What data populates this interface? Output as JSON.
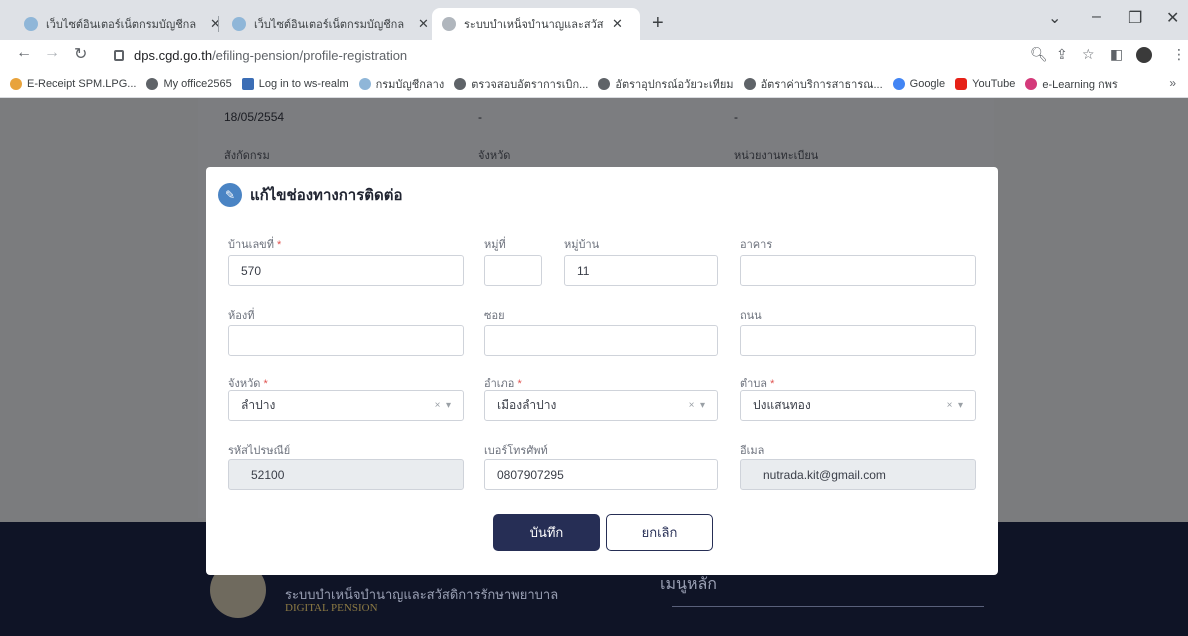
{
  "browser": {
    "tabs": [
      {
        "title": "เว็บไซต์อินเตอร์เน็ตกรมบัญชีกลาง"
      },
      {
        "title": "เว็บไซต์อินเตอร์เน็ตกรมบัญชีกลาง"
      },
      {
        "title": "ระบบบำเหน็จบำนาญและสวัสดิการรักษ"
      }
    ],
    "url_host": "dps.cgd.go.th",
    "url_path": "/efiling-pension/profile-registration",
    "bookmarks": [
      "E-Receipt SPM.LPG...",
      "My office2565",
      "Log in to ws-realm",
      "กรมบัญชีกลาง",
      "ตรวจสอบอัตราการเบิก...",
      "อัตราอุปกรณ์อวัยวะเทียม",
      "อัตราค่าบริการสาธารณ...",
      "Google",
      "YouTube",
      "e-Learning กพร"
    ]
  },
  "background": {
    "date_value": "18/05/2554",
    "dash1": "-",
    "dash2": "-",
    "label_dept": "สังกัดกรม",
    "label_province": "จังหวัด",
    "label_unit": "หน่วยงานทะเบียน",
    "footer_title": "ระบบบำเหน็จบำนาญและสวัสดิการรักษาพยาบาล",
    "footer_sub": "DIGITAL PENSION",
    "footer_menu": "เมนูหลัก"
  },
  "modal": {
    "title": "แก้ไขช่องทางการติดต่อ",
    "house_no_label": "บ้านเลขที่",
    "house_no_value": "570",
    "moo_label": "หมู่ที่",
    "moo_value": "",
    "village_label": "หมู่บ้าน",
    "village_value": "11",
    "building_label": "อาคาร",
    "building_value": "",
    "room_label": "ห้องที่",
    "room_value": "",
    "soi_label": "ซอย",
    "soi_value": "",
    "road_label": "ถนน",
    "road_value": "",
    "province_label": "จังหวัด",
    "province_value": "ลำปาง",
    "district_label": "อำเภอ",
    "district_value": "เมืองลำปาง",
    "subdistrict_label": "ตำบล",
    "subdistrict_value": "ปงแสนทอง",
    "postal_label": "รหัสไปรษณีย์",
    "postal_value": "52100",
    "phone_label": "เบอร์โทรศัพท์",
    "phone_value": "0807907295",
    "email_label": "อีเมล",
    "email_value": "nutrada.kit@gmail.com",
    "required_mark": "*",
    "save_label": "บันทึก",
    "cancel_label": "ยกเลิก",
    "select_clear": "×",
    "select_arrow": "▾"
  }
}
